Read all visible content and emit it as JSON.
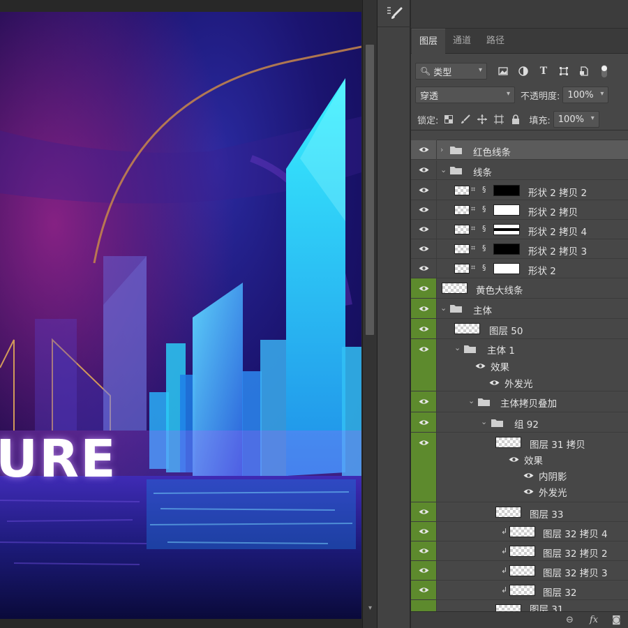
{
  "panel": {
    "tabs": [
      {
        "label": "图层",
        "active": true
      },
      {
        "label": "通道",
        "active": false
      },
      {
        "label": "路径",
        "active": false
      }
    ],
    "filter": {
      "kind_label": "类型",
      "icons": [
        "image-filter-icon",
        "adjustment-filter-icon",
        "type-filter-icon",
        "shape-filter-icon",
        "smart-object-filter-icon",
        "filter-toggle-icon"
      ]
    },
    "blend": {
      "mode": "穿透",
      "opacity_label": "不透明度:",
      "opacity_value": "100%"
    },
    "lock": {
      "label": "锁定:",
      "fill_label": "填充:",
      "fill_value": "100%"
    }
  },
  "poster": {
    "text": "URE"
  },
  "layers": [
    {
      "name": "红色线条",
      "kind": "group",
      "collapsed": true
    },
    {
      "name": "线条",
      "kind": "group",
      "collapsed": false
    },
    {
      "name": "形状 2 拷贝 2",
      "kind": "shape"
    },
    {
      "name": "形状 2 拷贝",
      "kind": "shape"
    },
    {
      "name": "形状 2 拷贝 4",
      "kind": "shape"
    },
    {
      "name": "形状 2 拷贝 3",
      "kind": "shape"
    },
    {
      "name": "形状 2",
      "kind": "shape"
    },
    {
      "name": "黄色大线条",
      "kind": "pixel"
    },
    {
      "name": "主体",
      "kind": "group"
    },
    {
      "name": "图层 50",
      "kind": "pixel"
    },
    {
      "name": "主体 1",
      "kind": "group"
    },
    {
      "name": "效果",
      "kind": "effects"
    },
    {
      "name": "外发光",
      "kind": "effect"
    },
    {
      "name": "主体拷贝叠加",
      "kind": "group"
    },
    {
      "name": "组 92",
      "kind": "group"
    },
    {
      "name": "图层 31 拷贝",
      "kind": "pixel"
    },
    {
      "name": "效果",
      "kind": "effects"
    },
    {
      "name": "内阴影",
      "kind": "effect"
    },
    {
      "name": "外发光",
      "kind": "effect"
    },
    {
      "name": "图层 33",
      "kind": "pixel"
    },
    {
      "name": "图层 32 拷贝 4",
      "kind": "pixel"
    },
    {
      "name": "图层 32 拷贝 2",
      "kind": "pixel"
    },
    {
      "name": "图层 32 拷贝 3",
      "kind": "pixel"
    },
    {
      "name": "图层 32",
      "kind": "pixel"
    },
    {
      "name": "图层 31",
      "kind": "pixel"
    }
  ],
  "colors": {
    "visible_green": "#5d8a2d",
    "panel_bg": "#474747",
    "selected_row": "#5b5b5b"
  }
}
